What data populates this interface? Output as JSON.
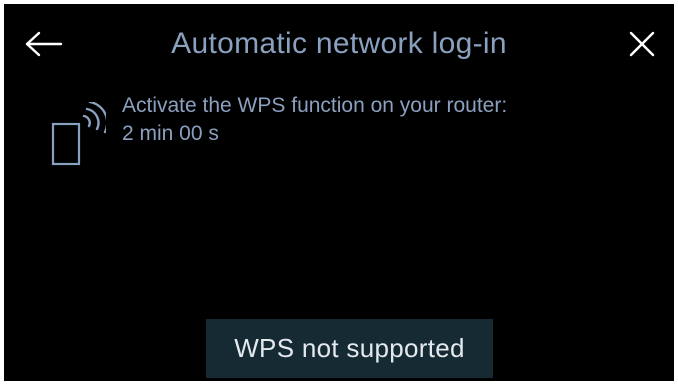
{
  "header": {
    "title": "Automatic network log-in",
    "back_icon": "arrow-left-icon",
    "close_icon": "close-icon"
  },
  "content": {
    "icon": "wps-router-icon",
    "instruction": "Activate the WPS function on your router:",
    "countdown": "2 min 00 s"
  },
  "footer": {
    "status_button_label": "WPS not supported"
  },
  "colors": {
    "background": "#000000",
    "accent_text": "#8aa0bf",
    "button_bg": "#162a33",
    "button_text": "#e4e9ee"
  }
}
